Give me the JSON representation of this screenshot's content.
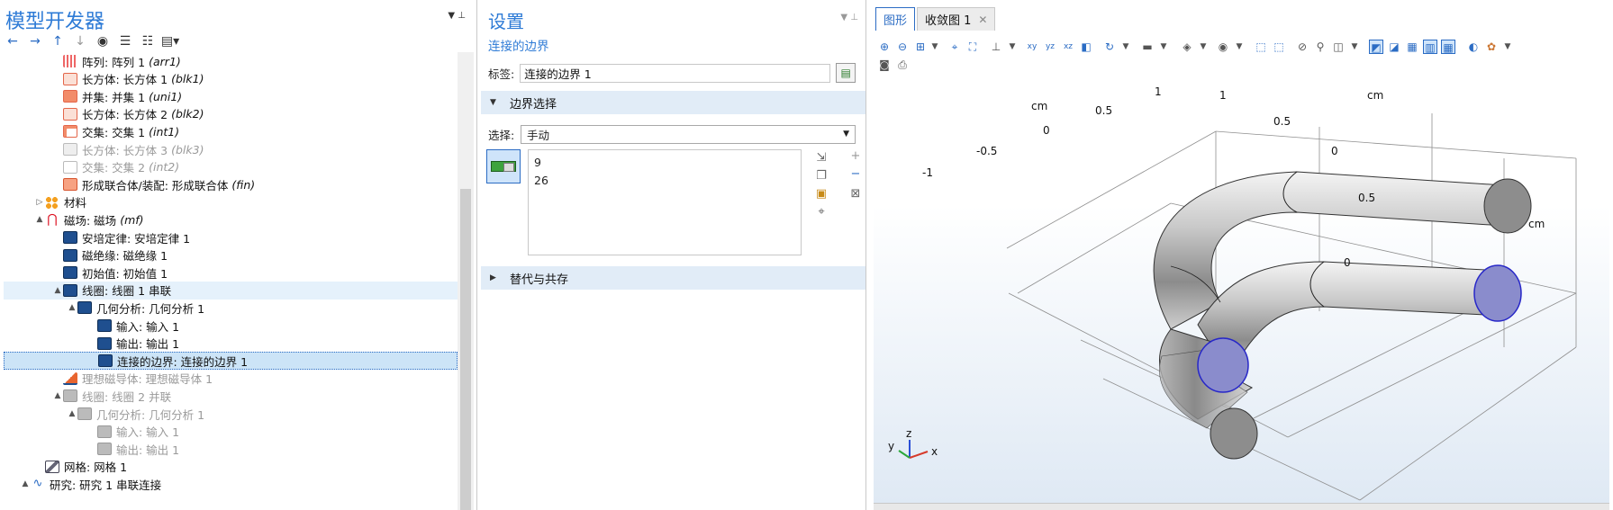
{
  "left_pane": {
    "title": "模型开发器",
    "tree": [
      {
        "label": "阵列: 阵列 1",
        "tag": "(arr1)",
        "icon": "array-icon",
        "depth": 3,
        "state": "normal"
      },
      {
        "label": "长方体: 长方体 1",
        "tag": "(blk1)",
        "icon": "block-icon",
        "depth": 3,
        "state": "normal"
      },
      {
        "label": "并集: 并集 1",
        "tag": "(uni1)",
        "icon": "union-icon",
        "depth": 3,
        "state": "normal"
      },
      {
        "label": "长方体: 长方体 2",
        "tag": "(blk2)",
        "icon": "block-icon",
        "depth": 3,
        "state": "normal"
      },
      {
        "label": "交集: 交集 1",
        "tag": "(int1)",
        "icon": "intersection-icon",
        "depth": 3,
        "state": "normal"
      },
      {
        "label": "长方体: 长方体 3",
        "tag": "(blk3)",
        "icon": "block-icon",
        "depth": 3,
        "state": "disabled"
      },
      {
        "label": "交集: 交集 2",
        "tag": "(int2)",
        "icon": "intersection-icon",
        "depth": 3,
        "state": "disabled"
      },
      {
        "label": "形成联合体/装配: 形成联合体",
        "tag": "(fin)",
        "icon": "form-union-icon",
        "depth": 3,
        "state": "normal"
      },
      {
        "label": "材料",
        "tag": "",
        "icon": "materials-icon",
        "depth": 2,
        "state": "normal",
        "expander": "collapsed"
      },
      {
        "label": "磁场: 磁场",
        "tag": "(mf)",
        "icon": "magnetic-field-icon",
        "depth": 2,
        "state": "normal",
        "expander": "expanded"
      },
      {
        "label": "安培定律: 安培定律 1",
        "tag": "",
        "icon": "physics-node-icon",
        "depth": 3,
        "state": "normal"
      },
      {
        "label": "磁绝缘: 磁绝缘 1",
        "tag": "",
        "icon": "physics-node-icon",
        "depth": 3,
        "state": "normal"
      },
      {
        "label": "初始值: 初始值 1",
        "tag": "",
        "icon": "physics-node-icon",
        "depth": 3,
        "state": "normal"
      },
      {
        "label": "线圈: 线圈 1 串联",
        "tag": "",
        "icon": "coil-icon",
        "depth": 3,
        "state": "highlighted",
        "expander": "expanded"
      },
      {
        "label": "几何分析: 几何分析 1",
        "tag": "",
        "icon": "geometry-analysis-icon",
        "depth": 4,
        "state": "normal",
        "expander": "expanded"
      },
      {
        "label": "输入: 输入 1",
        "tag": "",
        "icon": "input-icon",
        "depth": 5,
        "state": "normal"
      },
      {
        "label": "输出: 输出 1",
        "tag": "",
        "icon": "output-icon",
        "depth": 5,
        "state": "normal"
      },
      {
        "label": "连接的边界: 连接的边界 1",
        "tag": "",
        "icon": "connected-boundary-icon",
        "depth": 5,
        "state": "selected"
      },
      {
        "label": "理想磁导体: 理想磁导体 1",
        "tag": "",
        "icon": "perfect-magnetic-conductor-icon",
        "depth": 3,
        "state": "disabled"
      },
      {
        "label": "线圈: 线圈 2 并联",
        "tag": "",
        "icon": "coil-icon",
        "depth": 3,
        "state": "disabled",
        "expander": "expanded"
      },
      {
        "label": "几何分析: 几何分析 1",
        "tag": "",
        "icon": "geometry-analysis-icon",
        "depth": 4,
        "state": "disabled",
        "expander": "expanded"
      },
      {
        "label": "输入: 输入 1",
        "tag": "",
        "icon": "input-icon",
        "depth": 5,
        "state": "disabled"
      },
      {
        "label": "输出: 输出 1",
        "tag": "",
        "icon": "output-icon",
        "depth": 5,
        "state": "disabled"
      },
      {
        "label": "网格: 网格 1",
        "tag": "",
        "icon": "mesh-icon",
        "depth": 2,
        "state": "normal"
      },
      {
        "label": "研究: 研究 1 串联连接",
        "tag": "",
        "icon": "study-icon",
        "depth": 1,
        "state": "normal",
        "expander": "expanded"
      }
    ]
  },
  "settings_pane": {
    "title": "设置",
    "subtitle": "连接的边界",
    "label_caption": "标签:",
    "label_value": "连接的边界 1",
    "boundary_section": "边界选择",
    "selection_caption": "选择:",
    "selection_value": "手动",
    "selected_boundaries": [
      "9",
      "26"
    ],
    "override_section": "替代与共存"
  },
  "graphics_pane": {
    "tabs": [
      {
        "label": "图形",
        "active": true
      },
      {
        "label": "收敛图 1",
        "active": false
      }
    ],
    "axis_labels": {
      "unit": "cm",
      "x_ticks": [
        "-1",
        "-0.5",
        "0",
        "0.5",
        "1"
      ],
      "y_ticks": [
        "1",
        "0.5",
        "0"
      ],
      "z_ticks": [
        "0.5",
        "0"
      ]
    },
    "triad": {
      "x": "x",
      "y": "y",
      "z": "z"
    },
    "highlight_color": "#8a8ccc",
    "accent_color": "#2b6cc4"
  }
}
